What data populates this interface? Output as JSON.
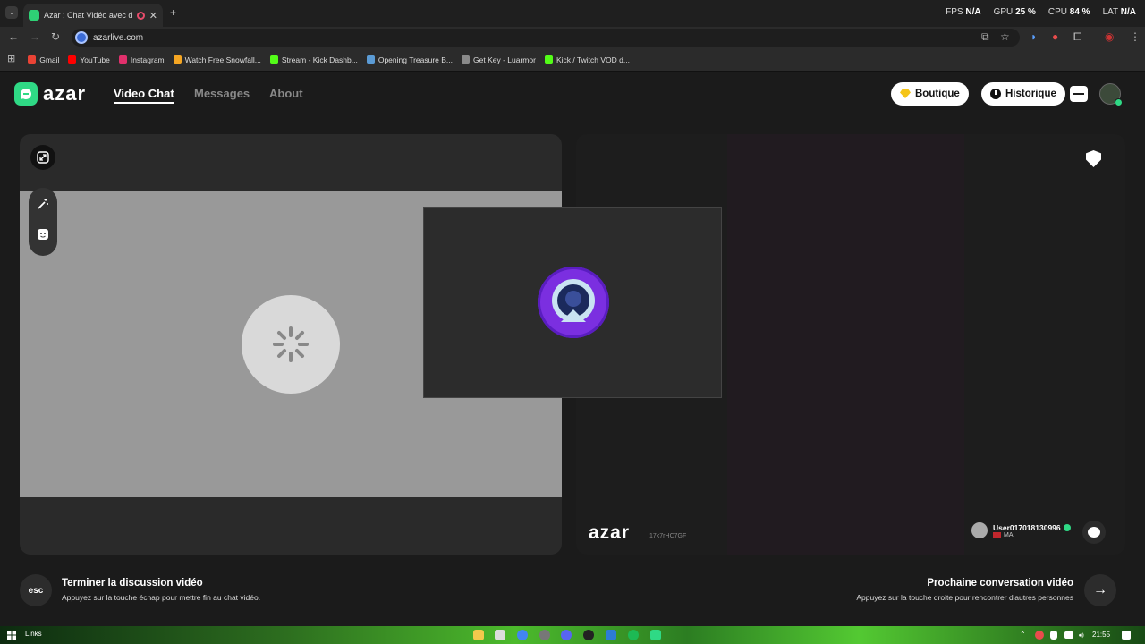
{
  "browser": {
    "tab_title": "Azar : Chat Vidéo avec de n",
    "url": "azarlive.com",
    "bookmarks": [
      {
        "label": "Gmail",
        "color": "#ea4335"
      },
      {
        "label": "YouTube",
        "color": "#ff0000"
      },
      {
        "label": "Instagram",
        "color": "#e1306c"
      },
      {
        "label": "Watch Free Snowfall...",
        "color": "#f5a623"
      },
      {
        "label": "Stream - Kick Dashb...",
        "color": "#53fc18"
      },
      {
        "label": "Opening Treasure B...",
        "color": "#5b9bd5"
      },
      {
        "label": "Get Key - Luarmor",
        "color": "#8a8a8a"
      },
      {
        "label": "Kick / Twitch VOD d...",
        "color": "#53fc18"
      }
    ],
    "perf": {
      "fps_label": "FPS",
      "fps_value": "N/A",
      "gpu_label": "GPU",
      "gpu_value": "25 %",
      "cpu_label": "CPU",
      "cpu_value": "84 %",
      "lat_label": "LAT",
      "lat_value": "N/A"
    }
  },
  "site": {
    "logo_text": "azar",
    "nav": {
      "video_chat": "Video Chat",
      "messages": "Messages",
      "about": "About"
    },
    "shop_label": "Boutique",
    "history_label": "Historique",
    "accent": "#2fd985"
  },
  "partner": {
    "watermark": "azar",
    "code": "17k7rHC7GF",
    "username": "User017018130996",
    "country": "MA"
  },
  "footer": {
    "esc_label": "esc",
    "end_title": "Terminer la discussion vidéo",
    "end_sub": "Appuyez sur la touche échap pour mettre fin au chat vidéo.",
    "next_title": "Prochaine conversation vidéo",
    "next_sub": "Appuyez sur la touche droite pour rencontrer d'autres personnes",
    "next_arrow": "→"
  },
  "taskbar": {
    "links_label": "Links",
    "clock": "21:55"
  }
}
